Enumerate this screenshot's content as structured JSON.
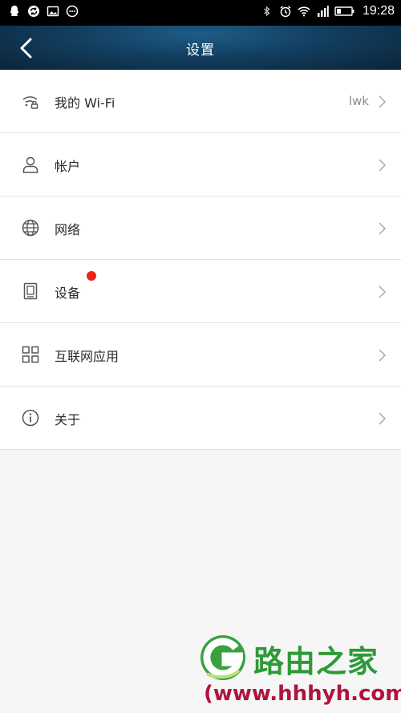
{
  "status_bar": {
    "time": "19:28",
    "icons_left": [
      "qq-icon",
      "sync-icon",
      "image-icon",
      "chat-icon"
    ],
    "icons_right": [
      "bluetooth-icon",
      "alarm-icon",
      "wifi-icon",
      "signal-icon",
      "battery-icon"
    ]
  },
  "header": {
    "title": "设置",
    "background_color": "#123e5f"
  },
  "menu": {
    "items": [
      {
        "label": "我的 Wi-Fi",
        "value": "lwk",
        "icon": "wifi-lock-icon"
      },
      {
        "label": "帐户",
        "value": "",
        "icon": "person-icon"
      },
      {
        "label": "网络",
        "value": "",
        "icon": "globe-icon"
      },
      {
        "label": "设备",
        "value": "",
        "icon": "device-icon",
        "badge": true
      },
      {
        "label": "互联网应用",
        "value": "",
        "icon": "apps-grid-icon"
      },
      {
        "label": "关于",
        "value": "",
        "icon": "info-icon"
      }
    ]
  },
  "watermark": {
    "brand": "路由之家",
    "url": "(www.hhhyh.com)",
    "brand_color": "#2e9a37",
    "url_color": "#b0143c"
  }
}
